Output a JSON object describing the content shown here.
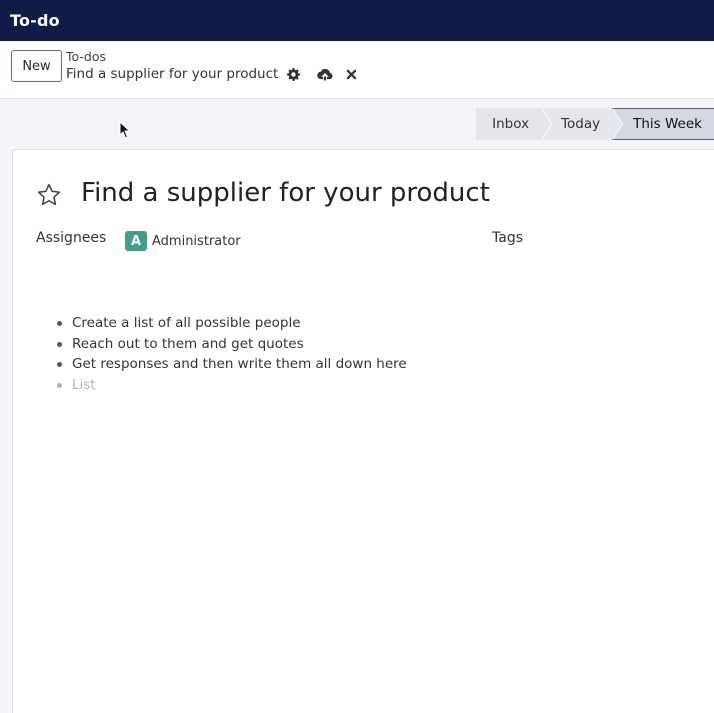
{
  "navbar": {
    "app_name": "To-do"
  },
  "control_panel": {
    "new_label": "New",
    "breadcrumb": "To-dos",
    "record_name": "Find a supplier for your product",
    "icons": [
      "gear-icon",
      "cloud-upload-icon",
      "close-icon"
    ]
  },
  "stages": {
    "items": [
      {
        "label": "Inbox"
      },
      {
        "label": "Today"
      },
      {
        "label": "This Week"
      }
    ],
    "active": "This Week"
  },
  "form": {
    "title": "Find a supplier for your product",
    "assignees_label": "Assignees",
    "assignee": {
      "initial": "A",
      "name": "Administrator",
      "color": "#3f9f8a"
    },
    "tags_label": "Tags",
    "notes": [
      "Create a list of all possible people",
      "Reach out to them and get quotes",
      "Get responses and then write them all down here"
    ],
    "notes_placeholder": "List"
  },
  "colors": {
    "navbar": "#111b47",
    "stage_active": "#d6d9e4",
    "stage": "#e4e6eb"
  }
}
